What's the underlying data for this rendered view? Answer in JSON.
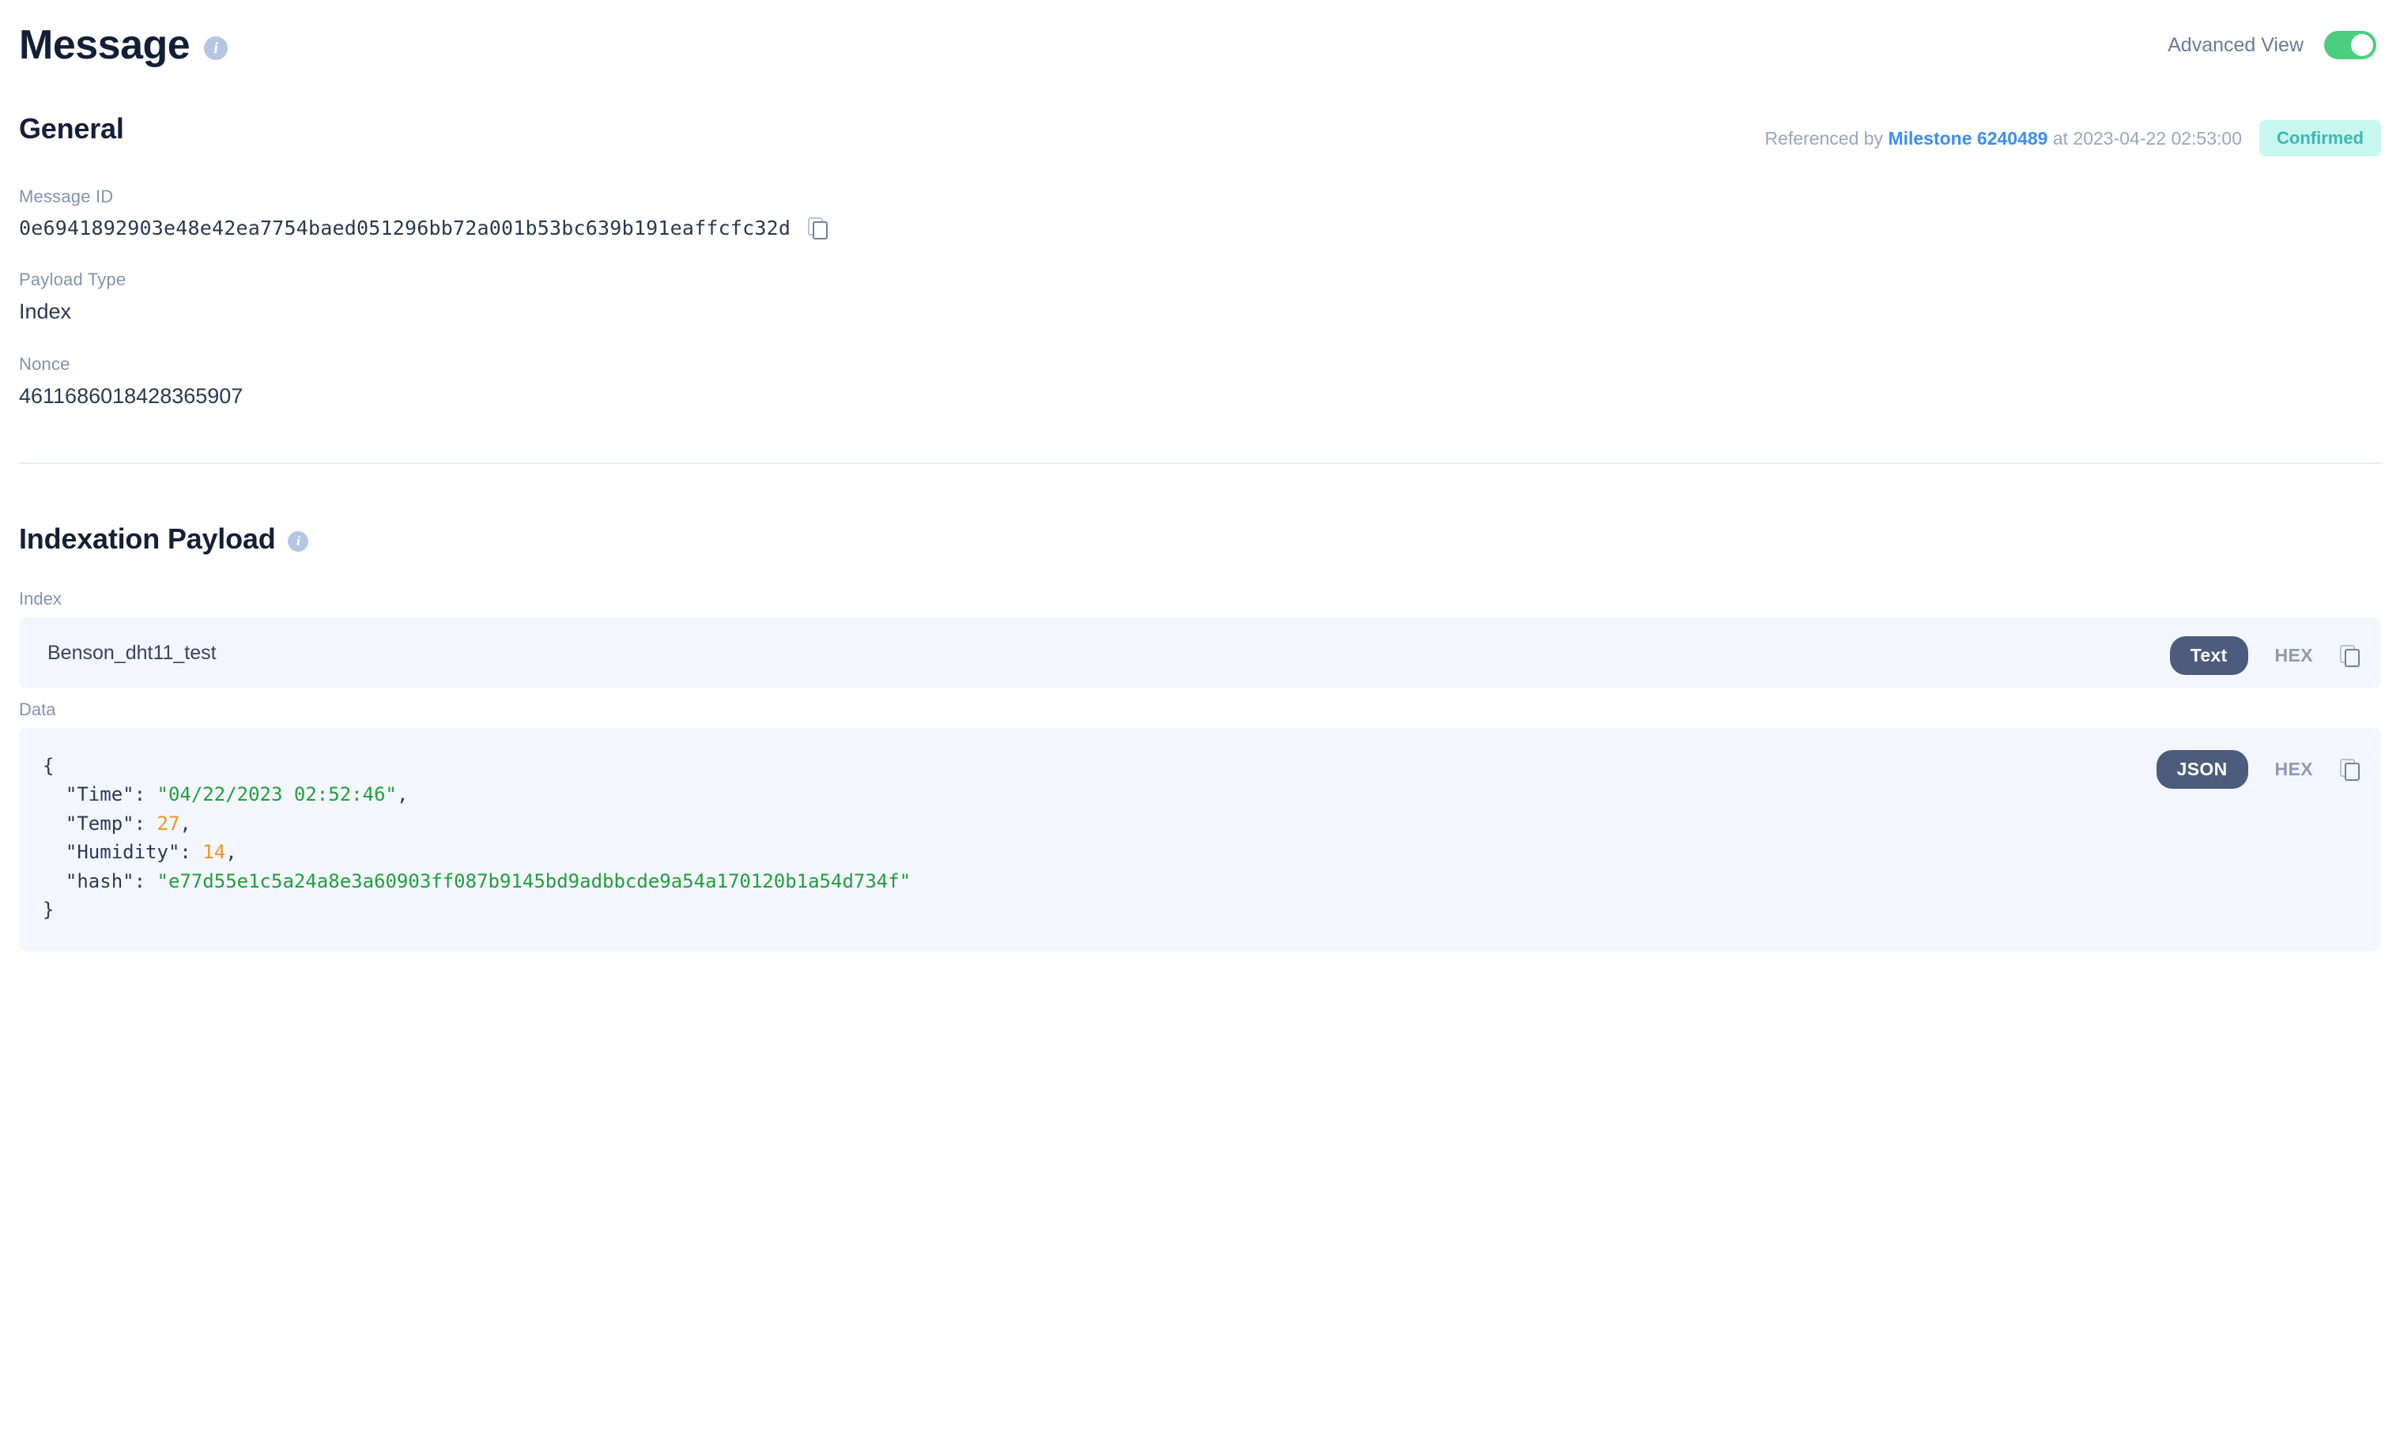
{
  "header": {
    "title": "Message",
    "info_icon": "info-icon",
    "advanced_view_label": "Advanced View",
    "advanced_view_enabled": true,
    "toggle_on_color": "#4cce7f"
  },
  "general": {
    "section_title": "General",
    "reference": {
      "prefix": "Referenced by",
      "milestone_label": "Milestone",
      "milestone_id": "6240489",
      "at_label": "at",
      "timestamp": "2023-04-22 02:53:00"
    },
    "status_badge": {
      "label": "Confirmed",
      "bg_color": "#c8f7ef",
      "text_color": "#3fb8b0"
    },
    "fields": [
      {
        "label": "Message ID",
        "value": "0e6941892903e48e42ea7754baed051296bb72a001b53bc639b191eaffcfc32d",
        "has_copy": true
      },
      {
        "label": "Payload Type",
        "value": "Index",
        "has_copy": false
      },
      {
        "label": "Nonce",
        "value": "4611686018428365907",
        "has_copy": false
      }
    ]
  },
  "indexation_payload": {
    "section_title": "Indexation Payload",
    "info_icon": "info-icon",
    "index": {
      "label": "Index",
      "value": "Benson_dht11_test",
      "format_active": "Text",
      "format_inactive": "HEX",
      "copy_icon": "copy-icon"
    },
    "data": {
      "label": "Data",
      "format_active": "JSON",
      "format_inactive": "HEX",
      "copy_icon": "copy-icon",
      "json_lines": [
        "{",
        "  \"Time\": \"04/22/2023 02:52:46\",",
        "  \"Temp\": 27,",
        "  \"Humidity\": 14,",
        "  \"hash\": \"e77d55e1c5a24a8e3a60903ff087b9145bd9adbbcde9a54a170120b1a54d734f\"",
        "}"
      ],
      "values": {
        "Time": "04/22/2023 02:52:46",
        "Temp": 27,
        "Humidity": 14,
        "hash": "e77d55e1c5a24a8e3a60903ff087b9145bd9adbbcde9a54a170120b1a54d734f"
      }
    }
  }
}
